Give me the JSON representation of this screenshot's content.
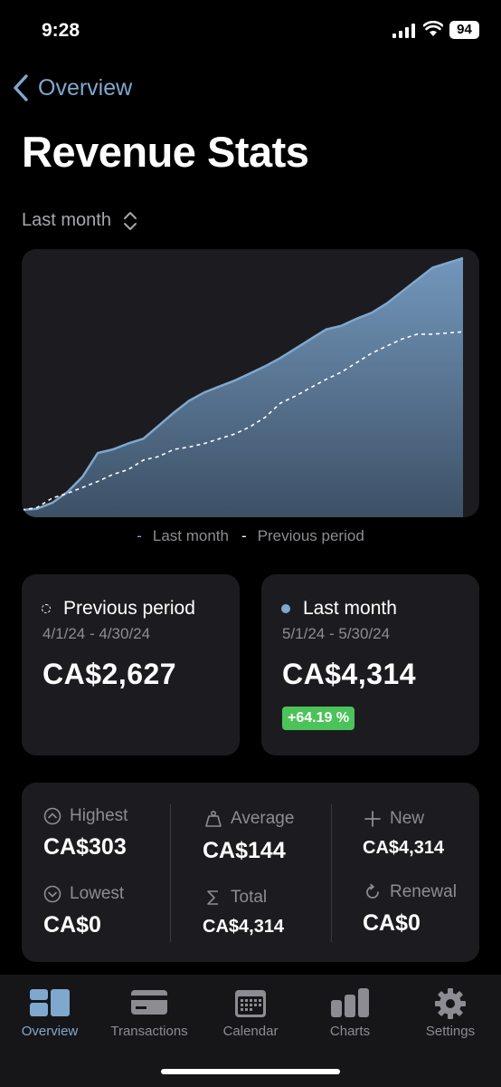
{
  "status_bar": {
    "time": "9:28",
    "battery": "94"
  },
  "nav": {
    "back_label": "Overview"
  },
  "page": {
    "title": "Revenue Stats",
    "period_selector": "Last month"
  },
  "chart_data": {
    "type": "area",
    "x": [
      1,
      2,
      3,
      4,
      5,
      6,
      7,
      8,
      9,
      10,
      11,
      12,
      13,
      14,
      15,
      16,
      17,
      18,
      19,
      20,
      21,
      22,
      23,
      24,
      25,
      26,
      27,
      28,
      29,
      30
    ],
    "series": [
      {
        "name": "Last month",
        "color": "#7fa8cf",
        "style": "filled-area",
        "values": [
          0,
          5,
          30,
          75,
          140,
          240,
          255,
          280,
          300,
          355,
          410,
          460,
          495,
          520,
          545,
          575,
          605,
          640,
          680,
          720,
          760,
          775,
          805,
          830,
          870,
          920,
          970,
          1020,
          1040,
          1060
        ]
      },
      {
        "name": "Previous period",
        "color": "#ffffff",
        "style": "dashed-line",
        "values": [
          0,
          10,
          50,
          70,
          95,
          120,
          150,
          170,
          210,
          225,
          255,
          265,
          280,
          300,
          320,
          350,
          390,
          450,
          480,
          515,
          550,
          580,
          620,
          660,
          690,
          720,
          740,
          740,
          745,
          750
        ]
      }
    ],
    "legend": [
      "Last month",
      "Previous period"
    ],
    "legend_position": "bottom"
  },
  "legend": {
    "current": "Last month",
    "previous": "Previous period"
  },
  "previous_card": {
    "label": "Previous period",
    "range": "4/1/24 - 4/30/24",
    "amount": "CA$2,627"
  },
  "current_card": {
    "label": "Last month",
    "range": "5/1/24 - 5/30/24",
    "amount": "CA$4,314",
    "change": "+64.19 %"
  },
  "stats": {
    "highest_label": "Highest",
    "highest": "CA$303",
    "lowest_label": "Lowest",
    "lowest": "CA$0",
    "average_label": "Average",
    "average": "CA$144",
    "total_label": "Total",
    "total": "CA$4,314",
    "new_label": "New",
    "new": "CA$4,314",
    "renewal_label": "Renewal",
    "renewal": "CA$0"
  },
  "tabs": [
    {
      "label": "Overview",
      "icon": "overview-icon",
      "active": true
    },
    {
      "label": "Transactions",
      "icon": "credit-card-icon"
    },
    {
      "label": "Calendar",
      "icon": "calendar-icon"
    },
    {
      "label": "Charts",
      "icon": "bar-chart-icon"
    },
    {
      "label": "Settings",
      "icon": "gear-icon"
    }
  ],
  "colors": {
    "accent": "#7fa8cf",
    "badge": "#4cc35a",
    "card": "#1c1c20"
  }
}
